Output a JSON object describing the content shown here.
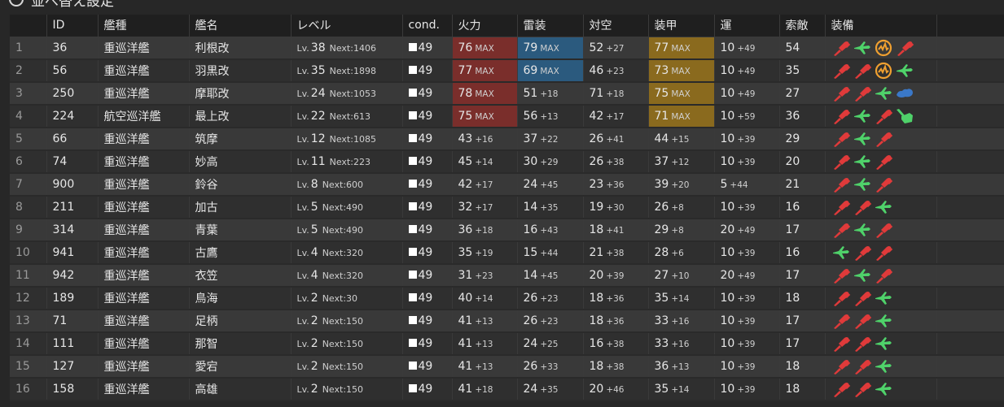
{
  "topbar": {
    "label": "並べ替え設定"
  },
  "columns": [
    "",
    "ID",
    "艦種",
    "艦名",
    "レベル",
    "cond.",
    "火力",
    "雷装",
    "対空",
    "装甲",
    "運",
    "索敵",
    "装備",
    ""
  ],
  "level_prefix": "Lv.",
  "next_prefix": "Next:",
  "max_label": "MAX",
  "colors": {
    "red": "#7a2e2b",
    "blue": "#2b5a7e",
    "gold": "#8a6a1e",
    "gun": "#e03a3a",
    "plane": "#4fd26a",
    "radar": "#f0a030",
    "sonar": "#3a78c8"
  },
  "ships": [
    {
      "num": "1",
      "id": "36",
      "type": "重巡洋艦",
      "name": "利根改",
      "lv": "38",
      "next": "1406",
      "cond": "49",
      "fp": {
        "v": "76",
        "s": "MAX",
        "hl": "red"
      },
      "tp": {
        "v": "79",
        "s": "MAX",
        "hl": "blue"
      },
      "aa": {
        "v": "52",
        "s": "+27"
      },
      "ar": {
        "v": "77",
        "s": "MAX",
        "hl": "gold"
      },
      "luck": {
        "v": "10",
        "s": "+49"
      },
      "los": "54",
      "equip": [
        "gun",
        "plane",
        "radar",
        "gun"
      ]
    },
    {
      "num": "2",
      "id": "56",
      "type": "重巡洋艦",
      "name": "羽黒改",
      "lv": "35",
      "next": "1898",
      "cond": "49",
      "fp": {
        "v": "77",
        "s": "MAX",
        "hl": "red"
      },
      "tp": {
        "v": "69",
        "s": "MAX",
        "hl": "blue"
      },
      "aa": {
        "v": "46",
        "s": "+23"
      },
      "ar": {
        "v": "73",
        "s": "MAX",
        "hl": "gold"
      },
      "luck": {
        "v": "10",
        "s": "+49"
      },
      "los": "35",
      "equip": [
        "gun",
        "gun",
        "radar",
        "plane"
      ]
    },
    {
      "num": "3",
      "id": "250",
      "type": "重巡洋艦",
      "name": "摩耶改",
      "lv": "24",
      "next": "1053",
      "cond": "49",
      "fp": {
        "v": "78",
        "s": "MAX",
        "hl": "red"
      },
      "tp": {
        "v": "51",
        "s": "+18"
      },
      "aa": {
        "v": "71",
        "s": "+18"
      },
      "ar": {
        "v": "75",
        "s": "MAX",
        "hl": "gold"
      },
      "luck": {
        "v": "10",
        "s": "+49"
      },
      "los": "27",
      "equip": [
        "gun",
        "gun",
        "plane",
        "sonar"
      ]
    },
    {
      "num": "4",
      "id": "224",
      "type": "航空巡洋艦",
      "name": "最上改",
      "lv": "22",
      "next": "613",
      "cond": "49",
      "fp": {
        "v": "75",
        "s": "MAX",
        "hl": "red"
      },
      "tp": {
        "v": "56",
        "s": "+13"
      },
      "aa": {
        "v": "42",
        "s": "+17"
      },
      "ar": {
        "v": "71",
        "s": "MAX",
        "hl": "gold"
      },
      "luck": {
        "v": "10",
        "s": "+59"
      },
      "los": "36",
      "equip": [
        "gun",
        "plane",
        "gun",
        "aagun"
      ]
    },
    {
      "num": "5",
      "id": "66",
      "type": "重巡洋艦",
      "name": "筑摩",
      "lv": "12",
      "next": "1085",
      "cond": "49",
      "fp": {
        "v": "43",
        "s": "+16"
      },
      "tp": {
        "v": "37",
        "s": "+22"
      },
      "aa": {
        "v": "26",
        "s": "+41"
      },
      "ar": {
        "v": "44",
        "s": "+15"
      },
      "luck": {
        "v": "10",
        "s": "+39"
      },
      "los": "29",
      "equip": [
        "gun",
        "plane",
        "gun"
      ]
    },
    {
      "num": "6",
      "id": "74",
      "type": "重巡洋艦",
      "name": "妙高",
      "lv": "11",
      "next": "223",
      "cond": "49",
      "fp": {
        "v": "45",
        "s": "+14"
      },
      "tp": {
        "v": "30",
        "s": "+29"
      },
      "aa": {
        "v": "26",
        "s": "+38"
      },
      "ar": {
        "v": "37",
        "s": "+12"
      },
      "luck": {
        "v": "10",
        "s": "+39"
      },
      "los": "20",
      "equip": [
        "gun",
        "plane",
        "gun"
      ]
    },
    {
      "num": "7",
      "id": "900",
      "type": "重巡洋艦",
      "name": "鈴谷",
      "lv": "8",
      "next": "600",
      "cond": "49",
      "fp": {
        "v": "42",
        "s": "+17"
      },
      "tp": {
        "v": "24",
        "s": "+45"
      },
      "aa": {
        "v": "23",
        "s": "+36"
      },
      "ar": {
        "v": "39",
        "s": "+20"
      },
      "luck": {
        "v": "5",
        "s": "+44"
      },
      "los": "21",
      "equip": [
        "gun",
        "plane",
        "gun"
      ]
    },
    {
      "num": "8",
      "id": "211",
      "type": "重巡洋艦",
      "name": "加古",
      "lv": "5",
      "next": "490",
      "cond": "49",
      "fp": {
        "v": "32",
        "s": "+17"
      },
      "tp": {
        "v": "14",
        "s": "+35"
      },
      "aa": {
        "v": "19",
        "s": "+30"
      },
      "ar": {
        "v": "26",
        "s": "+8"
      },
      "luck": {
        "v": "10",
        "s": "+39"
      },
      "los": "16",
      "equip": [
        "gun",
        "gun",
        "plane"
      ]
    },
    {
      "num": "9",
      "id": "314",
      "type": "重巡洋艦",
      "name": "青葉",
      "lv": "5",
      "next": "490",
      "cond": "49",
      "fp": {
        "v": "36",
        "s": "+18"
      },
      "tp": {
        "v": "16",
        "s": "+43"
      },
      "aa": {
        "v": "18",
        "s": "+41"
      },
      "ar": {
        "v": "29",
        "s": "+8"
      },
      "luck": {
        "v": "20",
        "s": "+49"
      },
      "los": "17",
      "equip": [
        "gun",
        "plane",
        "gun"
      ]
    },
    {
      "num": "10",
      "id": "941",
      "type": "重巡洋艦",
      "name": "古鷹",
      "lv": "4",
      "next": "320",
      "cond": "49",
      "fp": {
        "v": "35",
        "s": "+19"
      },
      "tp": {
        "v": "15",
        "s": "+44"
      },
      "aa": {
        "v": "21",
        "s": "+38"
      },
      "ar": {
        "v": "28",
        "s": "+6"
      },
      "luck": {
        "v": "10",
        "s": "+39"
      },
      "los": "16",
      "equip": [
        "plane",
        "gun",
        "gun"
      ]
    },
    {
      "num": "11",
      "id": "942",
      "type": "重巡洋艦",
      "name": "衣笠",
      "lv": "4",
      "next": "320",
      "cond": "49",
      "fp": {
        "v": "31",
        "s": "+23"
      },
      "tp": {
        "v": "14",
        "s": "+45"
      },
      "aa": {
        "v": "20",
        "s": "+39"
      },
      "ar": {
        "v": "27",
        "s": "+10"
      },
      "luck": {
        "v": "20",
        "s": "+49"
      },
      "los": "17",
      "equip": [
        "gun",
        "plane",
        "gun"
      ]
    },
    {
      "num": "12",
      "id": "189",
      "type": "重巡洋艦",
      "name": "鳥海",
      "lv": "2",
      "next": "30",
      "cond": "49",
      "fp": {
        "v": "40",
        "s": "+14"
      },
      "tp": {
        "v": "26",
        "s": "+23"
      },
      "aa": {
        "v": "18",
        "s": "+36"
      },
      "ar": {
        "v": "35",
        "s": "+14"
      },
      "luck": {
        "v": "10",
        "s": "+39"
      },
      "los": "18",
      "equip": [
        "gun",
        "gun",
        "plane"
      ]
    },
    {
      "num": "13",
      "id": "71",
      "type": "重巡洋艦",
      "name": "足柄",
      "lv": "2",
      "next": "150",
      "cond": "49",
      "fp": {
        "v": "41",
        "s": "+13"
      },
      "tp": {
        "v": "26",
        "s": "+23"
      },
      "aa": {
        "v": "18",
        "s": "+36"
      },
      "ar": {
        "v": "33",
        "s": "+16"
      },
      "luck": {
        "v": "10",
        "s": "+39"
      },
      "los": "17",
      "equip": [
        "gun",
        "gun",
        "plane"
      ]
    },
    {
      "num": "14",
      "id": "111",
      "type": "重巡洋艦",
      "name": "那智",
      "lv": "2",
      "next": "150",
      "cond": "49",
      "fp": {
        "v": "41",
        "s": "+13"
      },
      "tp": {
        "v": "24",
        "s": "+25"
      },
      "aa": {
        "v": "16",
        "s": "+38"
      },
      "ar": {
        "v": "33",
        "s": "+16"
      },
      "luck": {
        "v": "10",
        "s": "+39"
      },
      "los": "17",
      "equip": [
        "gun",
        "gun",
        "plane"
      ]
    },
    {
      "num": "15",
      "id": "127",
      "type": "重巡洋艦",
      "name": "愛宕",
      "lv": "2",
      "next": "150",
      "cond": "49",
      "fp": {
        "v": "41",
        "s": "+13"
      },
      "tp": {
        "v": "26",
        "s": "+33"
      },
      "aa": {
        "v": "18",
        "s": "+38"
      },
      "ar": {
        "v": "36",
        "s": "+13"
      },
      "luck": {
        "v": "10",
        "s": "+39"
      },
      "los": "18",
      "equip": [
        "gun",
        "gun",
        "plane"
      ]
    },
    {
      "num": "16",
      "id": "158",
      "type": "重巡洋艦",
      "name": "高雄",
      "lv": "2",
      "next": "150",
      "cond": "49",
      "fp": {
        "v": "41",
        "s": "+18"
      },
      "tp": {
        "v": "24",
        "s": "+35"
      },
      "aa": {
        "v": "20",
        "s": "+46"
      },
      "ar": {
        "v": "35",
        "s": "+14"
      },
      "luck": {
        "v": "10",
        "s": "+39"
      },
      "los": "18",
      "equip": [
        "gun",
        "gun",
        "plane"
      ]
    }
  ]
}
